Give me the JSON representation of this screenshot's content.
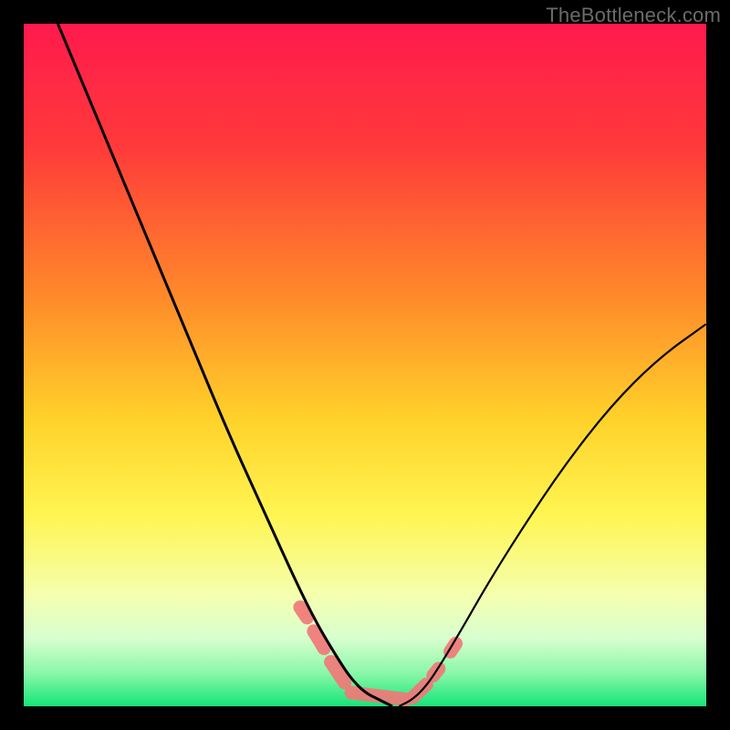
{
  "watermark": "TheBottleneck.com",
  "chart_data": {
    "type": "line",
    "title": "",
    "xlabel": "",
    "ylabel": "",
    "xlim": [
      0,
      100
    ],
    "ylim": [
      0,
      100
    ],
    "gradient_stops": [
      {
        "offset": 0.0,
        "color": "#ff1a4d"
      },
      {
        "offset": 0.18,
        "color": "#ff3a3a"
      },
      {
        "offset": 0.4,
        "color": "#ff8a2a"
      },
      {
        "offset": 0.58,
        "color": "#ffd22a"
      },
      {
        "offset": 0.72,
        "color": "#fff552"
      },
      {
        "offset": 0.84,
        "color": "#f4ffb0"
      },
      {
        "offset": 0.9,
        "color": "#d8ffcf"
      },
      {
        "offset": 0.95,
        "color": "#8cf7a9"
      },
      {
        "offset": 1.0,
        "color": "#16e678"
      }
    ],
    "series": [
      {
        "name": "left-curve",
        "stroke_width": 3,
        "x": [
          5,
          10,
          15,
          20,
          25,
          30,
          35,
          40,
          43,
          46,
          48,
          50,
          52,
          54
        ],
        "y": [
          100,
          88,
          76,
          64,
          52,
          40,
          29,
          18,
          12,
          7,
          4,
          2,
          1,
          0
        ]
      },
      {
        "name": "right-curve",
        "stroke_width": 2.2,
        "x": [
          55,
          57,
          59,
          61,
          64,
          68,
          73,
          79,
          86,
          93,
          100
        ],
        "y": [
          0,
          1,
          3,
          6,
          11,
          18,
          26,
          35,
          44,
          51,
          56
        ]
      }
    ],
    "noise_segments": [
      {
        "x1": 40.5,
        "y1": 14.5,
        "x2": 41.5,
        "y2": 13.0
      },
      {
        "x1": 42.5,
        "y1": 11.0,
        "x2": 44.0,
        "y2": 8.5
      },
      {
        "x1": 45.0,
        "y1": 6.5,
        "x2": 47.0,
        "y2": 3.5
      },
      {
        "x1": 48.0,
        "y1": 2.0,
        "x2": 56.0,
        "y2": 1.0
      },
      {
        "x1": 57.0,
        "y1": 1.3,
        "x2": 59.0,
        "y2": 3.2
      },
      {
        "x1": 60.0,
        "y1": 4.5,
        "x2": 60.8,
        "y2": 5.5
      },
      {
        "x1": 62.5,
        "y1": 8.0,
        "x2": 63.3,
        "y2": 9.2
      }
    ]
  }
}
